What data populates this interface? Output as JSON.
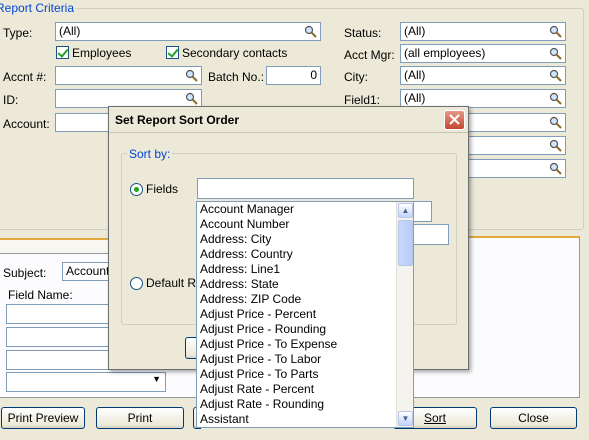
{
  "report_criteria": {
    "legend": "Report Criteria",
    "type_label": "Type:",
    "type_value": "(All)",
    "employees_label": "Employees",
    "secondary_contacts_label": "Secondary contacts",
    "accnt_label": "Accnt #:",
    "accnt_value": "",
    "batch_label": "Batch No.:",
    "batch_value": "0",
    "id_label": "ID:",
    "account_label": "Account:",
    "status_label": "Status:",
    "status_value": "(All)",
    "acct_mgr_label": "Acct Mgr:",
    "acct_mgr_value": "(all employees)",
    "city_label": "City:",
    "city_value": "(All)",
    "field1_label": "Field1:",
    "field1_value": "(All)"
  },
  "lower_panel": {
    "subject_label": "Subject:",
    "subject_value": "Account",
    "field_name_label": "Field Name:"
  },
  "dialog": {
    "title": "Set Report Sort Order",
    "sort_by_legend": "Sort by:",
    "fields_label": "Fields",
    "default_label": "Default R",
    "fields_value": "",
    "list_items": [
      "Account Manager",
      "Account Number",
      "Address: City",
      "Address: Country",
      "Address: Line1",
      "Address: State",
      "Address: ZIP Code",
      "Adjust Price - Percent",
      "Adjust Price - Rounding",
      "Adjust Price - To Expense",
      "Adjust Price - To Labor",
      "Adjust Price - To Parts",
      "Adjust Rate - Percent",
      "Adjust Rate - Rounding",
      "Assistant"
    ]
  },
  "bottom_bar": {
    "print_preview": "Print Preview",
    "print": "Print",
    "sort": "Sort",
    "close": "Close"
  }
}
